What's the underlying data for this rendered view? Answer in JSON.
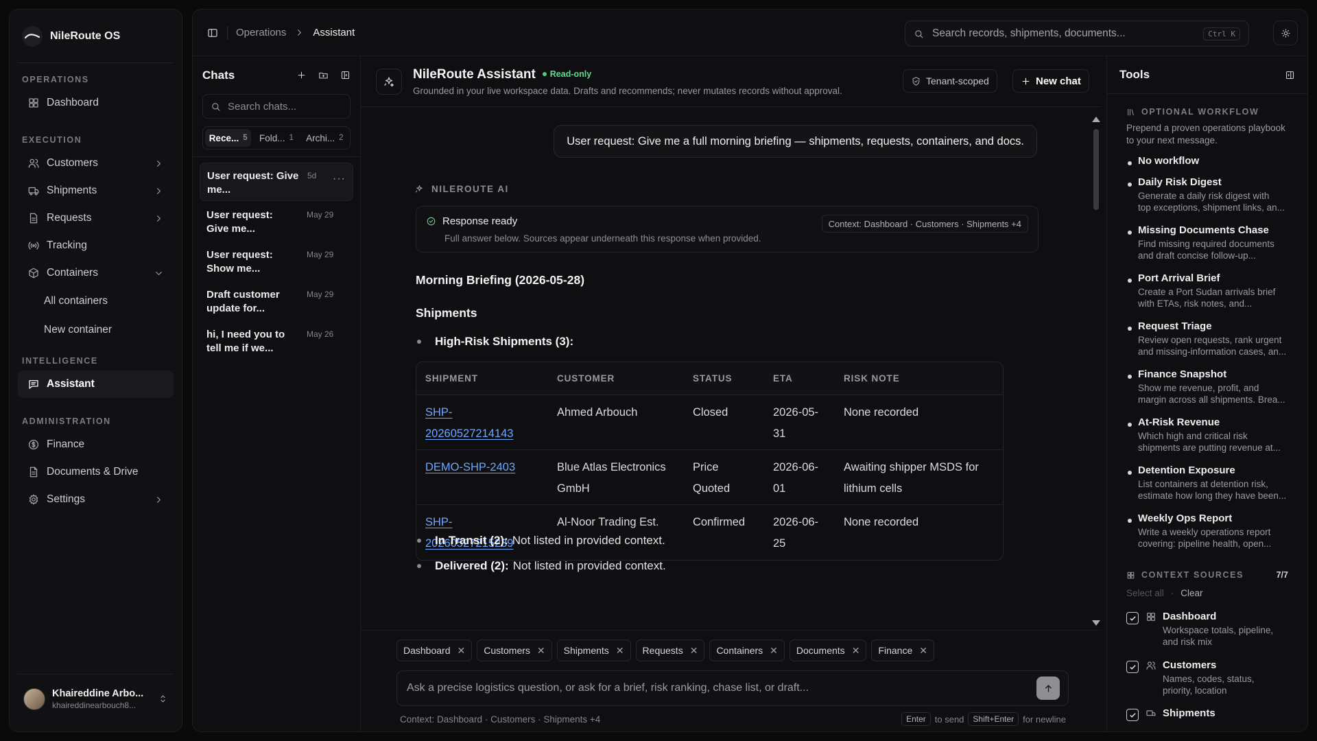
{
  "sidebar": {
    "brand": "NileRoute OS",
    "sections": {
      "operations": "OPERATIONS",
      "execution": "EXECUTION",
      "intelligence": "INTELLIGENCE",
      "administration": "ADMINISTRATION"
    },
    "items": {
      "dashboard": "Dashboard",
      "customers": "Customers",
      "shipments": "Shipments",
      "requests": "Requests",
      "tracking": "Tracking",
      "containers": "Containers",
      "all_containers": "All containers",
      "new_container": "New container",
      "assistant": "Assistant",
      "finance": "Finance",
      "documents": "Documents & Drive",
      "settings": "Settings"
    },
    "user": {
      "name": "Khaireddine Arbo...",
      "email": "khaireddinearbouch8..."
    }
  },
  "topbar": {
    "crumb_parent": "Operations",
    "crumb_current": "Assistant",
    "search_placeholder": "Search records, shipments, documents...",
    "search_shortcut": "Ctrl K"
  },
  "chats": {
    "title": "Chats",
    "search_placeholder": "Search chats...",
    "tabs": [
      {
        "label": "Rece...",
        "count": "5"
      },
      {
        "label": "Fold...",
        "count": "1"
      },
      {
        "label": "Archi...",
        "count": "2"
      }
    ],
    "items": [
      {
        "line1": "User request: Give",
        "line2": "me...",
        "date": "5d"
      },
      {
        "line1": "User request:",
        "line2": "Give me...",
        "date": "May 29"
      },
      {
        "line1": "User request:",
        "line2": "Show me...",
        "date": "May 29"
      },
      {
        "line1": "Draft customer",
        "line2": "update for...",
        "date": "May 29"
      },
      {
        "line1": "hi, I need you to",
        "line2": "tell me if we...",
        "date": "May 26"
      }
    ]
  },
  "assistant": {
    "title": "NileRoute Assistant",
    "badge": "Read-only",
    "subtitle": "Grounded in your live workspace data. Drafts and recommends; never mutates records without approval.",
    "tenant_label": "Tenant-scoped",
    "new_chat_label": "New chat"
  },
  "conversation": {
    "user_message": "User request: Give me a full morning briefing — shipments, requests, containers, and docs.",
    "ai_label": "NILEROUTE AI",
    "status_title": "Response ready",
    "status_sub": "Full answer below. Sources appear underneath this response when provided.",
    "context_pill": "Context: Dashboard · Customers · Shipments +4",
    "heading": "Morning Briefing (2026-05-28)",
    "section": "Shipments",
    "high_risk_label": "High-Risk Shipments (3):",
    "table": {
      "headers": [
        "SHIPMENT",
        "CUSTOMER",
        "STATUS",
        "ETA",
        "RISK NOTE"
      ],
      "rows": [
        {
          "shipment_1": "SHP-",
          "shipment_2": "20260527214143",
          "customer_1": "Ahmed Arbouch",
          "customer_2": "",
          "status_1": "Closed",
          "status_2": "",
          "eta_1": "2026-05-",
          "eta_2": "31",
          "note_1": "None recorded",
          "note_2": ""
        },
        {
          "shipment_1": "DEMO-SHP-2403",
          "shipment_2": "",
          "customer_1": "Blue Atlas Electronics",
          "customer_2": "GmbH",
          "status_1": "Price",
          "status_2": "Quoted",
          "eta_1": "2026-06-",
          "eta_2": "01",
          "note_1": "Awaiting shipper MSDS for",
          "note_2": "lithium cells"
        },
        {
          "shipment_1": "SHP-",
          "shipment_2": "20260527215239",
          "customer_1": "Al-Noor Trading Est.",
          "customer_2": "",
          "status_1": "Confirmed",
          "status_2": "",
          "eta_1": "2026-06-",
          "eta_2": "25",
          "note_1": "None recorded",
          "note_2": ""
        }
      ]
    },
    "in_transit_label": "In Transit (2):",
    "in_transit_text": "Not listed in provided context.",
    "delivered_label": "Delivered (2):",
    "delivered_text": "Not listed in provided context."
  },
  "composer": {
    "chips": [
      "Dashboard",
      "Customers",
      "Shipments",
      "Requests",
      "Containers",
      "Documents",
      "Finance"
    ],
    "placeholder": "Ask a precise logistics question, or ask for a brief, risk ranking, chase list, or draft...",
    "context_text": "Context: Dashboard · Customers · Shipments +4",
    "send_key": "Enter",
    "send_text": "to send",
    "newline_key": "Shift+Enter",
    "newline_text": "for newline"
  },
  "tools": {
    "title": "Tools",
    "workflow_section": "OPTIONAL WORKFLOW",
    "workflow_desc": "Prepend a proven operations playbook to your next message.",
    "workflows": [
      {
        "title": "No workflow",
        "desc": ""
      },
      {
        "title": "Daily Risk Digest",
        "desc1": "Generate a daily risk digest with",
        "desc2": "top exceptions, shipment links, an..."
      },
      {
        "title": "Missing Documents Chase",
        "desc1": "Find missing required documents",
        "desc2": "and draft concise follow-up..."
      },
      {
        "title": "Port Arrival Brief",
        "desc1": "Create a Port Sudan arrivals brief",
        "desc2": "with ETAs, risk notes, and..."
      },
      {
        "title": "Request Triage",
        "desc1": "Review open requests, rank urgent",
        "desc2": "and missing-information cases, an..."
      },
      {
        "title": "Finance Snapshot",
        "desc1": "Show me revenue, profit, and",
        "desc2": "margin across all shipments. Brea..."
      },
      {
        "title": "At-Risk Revenue",
        "desc1": "Which high and critical risk",
        "desc2": "shipments are putting revenue at..."
      },
      {
        "title": "Detention Exposure",
        "desc1": "List containers at detention risk,",
        "desc2": "estimate how long they have been..."
      },
      {
        "title": "Weekly Ops Report",
        "desc1": "Write a weekly operations report",
        "desc2": "covering: pipeline health, open..."
      }
    ],
    "sources_section": "CONTEXT SOURCES",
    "sources_count": "7/7",
    "select_all": "Select all",
    "clear": "Clear",
    "sources": [
      {
        "title": "Dashboard",
        "desc1": "Workspace totals, pipeline,",
        "desc2": "and risk mix"
      },
      {
        "title": "Customers",
        "desc1": "Names, codes, status,",
        "desc2": "priority, location"
      },
      {
        "title": "Shipments"
      }
    ]
  }
}
